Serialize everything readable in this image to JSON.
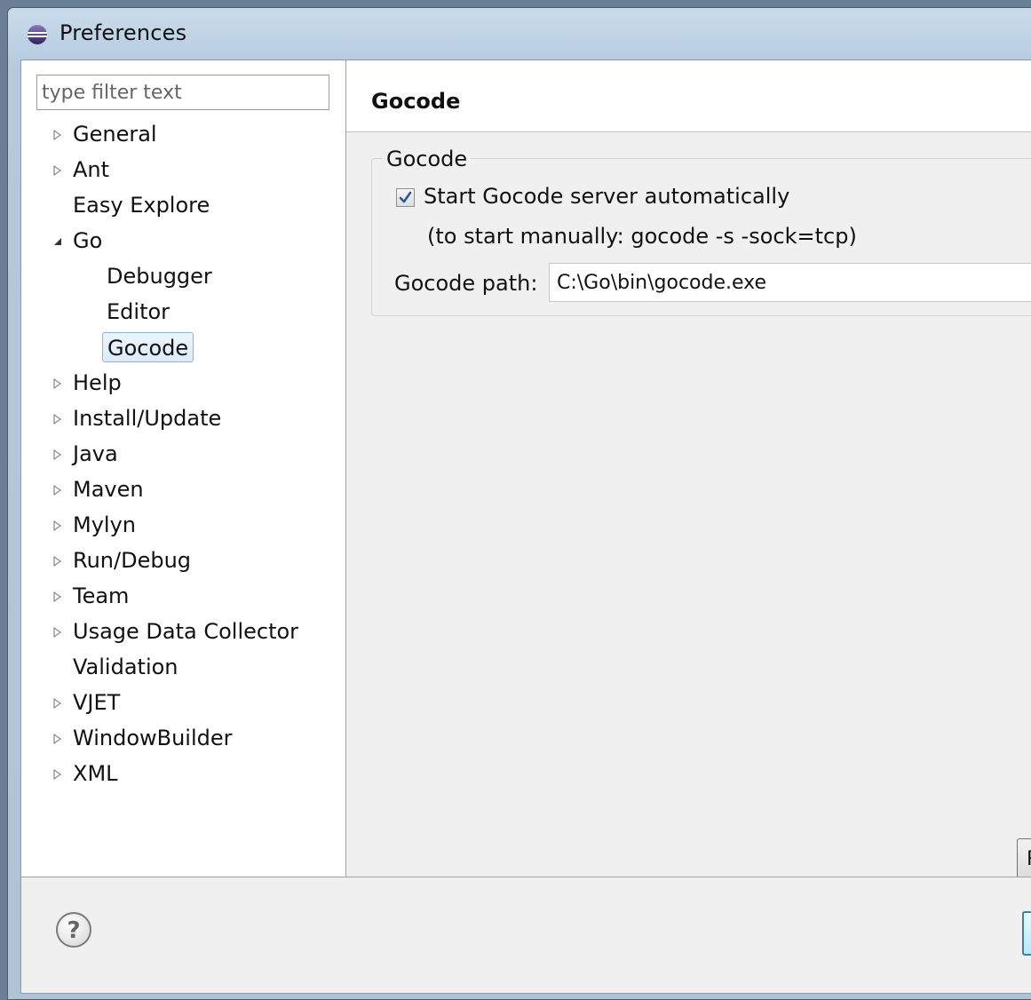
{
  "window": {
    "title": "Preferences"
  },
  "sidebar": {
    "filter_placeholder": "type filter text",
    "items": [
      {
        "label": "General",
        "expander": "collapsed",
        "indent": 0
      },
      {
        "label": "Ant",
        "expander": "collapsed",
        "indent": 0
      },
      {
        "label": "Easy Explore",
        "expander": "none",
        "indent": 0
      },
      {
        "label": "Go",
        "expander": "expanded",
        "indent": 0
      },
      {
        "label": "Debugger",
        "expander": "none",
        "indent": 1
      },
      {
        "label": "Editor",
        "expander": "none",
        "indent": 1
      },
      {
        "label": "Gocode",
        "expander": "none",
        "indent": 1,
        "selected": true
      },
      {
        "label": "Help",
        "expander": "collapsed",
        "indent": 0
      },
      {
        "label": "Install/Update",
        "expander": "collapsed",
        "indent": 0
      },
      {
        "label": "Java",
        "expander": "collapsed",
        "indent": 0
      },
      {
        "label": "Maven",
        "expander": "collapsed",
        "indent": 0
      },
      {
        "label": "Mylyn",
        "expander": "collapsed",
        "indent": 0
      },
      {
        "label": "Run/Debug",
        "expander": "collapsed",
        "indent": 0
      },
      {
        "label": "Team",
        "expander": "collapsed",
        "indent": 0
      },
      {
        "label": "Usage Data Collector",
        "expander": "collapsed",
        "indent": 0
      },
      {
        "label": "Validation",
        "expander": "none",
        "indent": 0
      },
      {
        "label": "VJET",
        "expander": "collapsed",
        "indent": 0
      },
      {
        "label": "WindowBuilder",
        "expander": "collapsed",
        "indent": 0
      },
      {
        "label": "XML",
        "expander": "collapsed",
        "indent": 0
      }
    ]
  },
  "page": {
    "title": "Gocode",
    "group": {
      "title": "Gocode",
      "checkbox_label": "Start Gocode server automatically",
      "checkbox_checked": true,
      "hint": "(to start manually: gocode -s -sock=tcp)",
      "path_label": "Gocode path:",
      "path_value": "C:\\Go\\bin\\gocode.exe"
    },
    "restore_button_label": "R"
  },
  "colors": {
    "selection_border": "#84b6e3",
    "selection_fill": "#d9ebfa",
    "check_mark": "#2a5c9a"
  }
}
